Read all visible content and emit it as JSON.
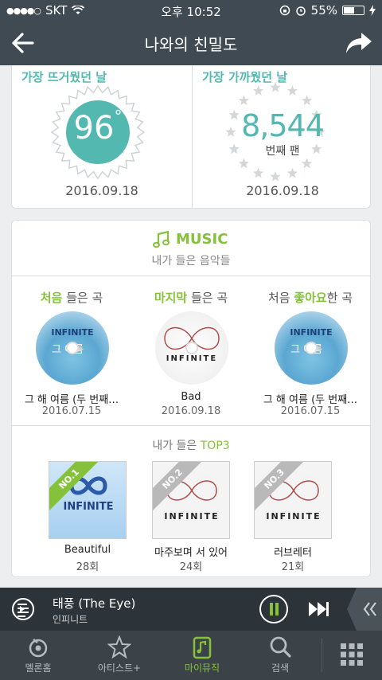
{
  "status_bar": {
    "carrier": "SKT",
    "time": "오후 10:52",
    "battery": "55%",
    "battery_level": 0.55
  },
  "header": {
    "title": "나와의 친밀도"
  },
  "stats": {
    "hottest": {
      "label": "가장 뜨거웠던 날",
      "temperature": "96",
      "degree": "°",
      "date": "2016.09.18"
    },
    "closest": {
      "label": "가장 가까웠던 날",
      "rank": "8,544",
      "rank_suffix": "번째 팬",
      "date": "2016.09.18"
    }
  },
  "music": {
    "title": "MUSIC",
    "subtitle": "내가 들은 음악들",
    "songs": [
      {
        "caption_hl": "처음",
        "caption_rest": " 들은 곡",
        "name": "그 해 여름 (두 번째…",
        "date": "2016.07.15"
      },
      {
        "caption_hl": "마지막",
        "caption_rest": " 들은 곡",
        "name": "Bad",
        "date": "2016.09.18"
      },
      {
        "caption_pre": "처음 ",
        "caption_hl": "좋아요",
        "caption_rest": "한 곡",
        "name": "그 해 여름 (두 번째…",
        "date": "2016.07.15"
      }
    ],
    "top3_title_pre": "내가 들은 ",
    "top3_title_hl": "TOP3",
    "top3": [
      {
        "rank": "NO.1",
        "name": "Beautiful",
        "count": "28회",
        "cover_text": "INFINITE"
      },
      {
        "rank": "NO.2",
        "name": "마주보며 서 있어",
        "count": "24회",
        "cover_text": "INFINITE"
      },
      {
        "rank": "NO.3",
        "name": "러브레터",
        "count": "21회",
        "cover_text": "INFINITE"
      }
    ],
    "cd_text": "INFINITE"
  },
  "player": {
    "track": "태풍 (The Eye)",
    "artist": "인피니트"
  },
  "tabs": [
    {
      "label": "멜론홈",
      "icon": "melon-home-icon"
    },
    {
      "label": "아티스트+",
      "icon": "star-icon"
    },
    {
      "label": "마이뮤직",
      "icon": "my-music-icon",
      "active": true
    },
    {
      "label": "검색",
      "icon": "search-icon"
    }
  ],
  "colors": {
    "accent_green": "#85c23a",
    "teal": "#52b8b0",
    "dark_bar": "#3f4a52"
  }
}
